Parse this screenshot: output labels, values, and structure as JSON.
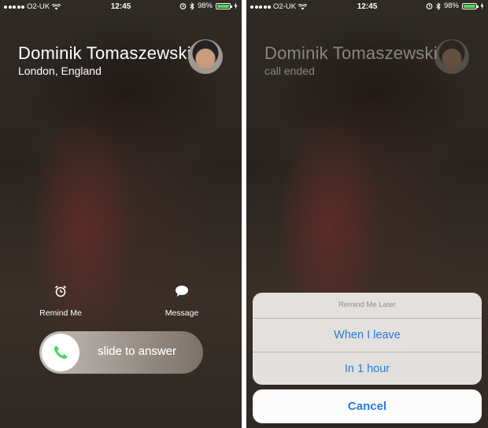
{
  "status": {
    "carrier": "O2-UK",
    "time": "12:45",
    "battery": "98%",
    "battery_level": 0.98
  },
  "left": {
    "caller_name": "Dominik Tomaszewski",
    "caller_location": "London, England",
    "remind_label": "Remind Me",
    "message_label": "Message",
    "slide_label": "slide to answer"
  },
  "right": {
    "caller_name": "Dominik Tomaszewski",
    "call_status": "call ended",
    "sheet": {
      "title": "Remind Me Later",
      "options": [
        "When I leave",
        "In 1 hour"
      ],
      "cancel": "Cancel"
    }
  },
  "colors": {
    "accent": "#2a7ae2",
    "battery_fill": "#5ad25a",
    "answer_green": "#4cd964"
  }
}
